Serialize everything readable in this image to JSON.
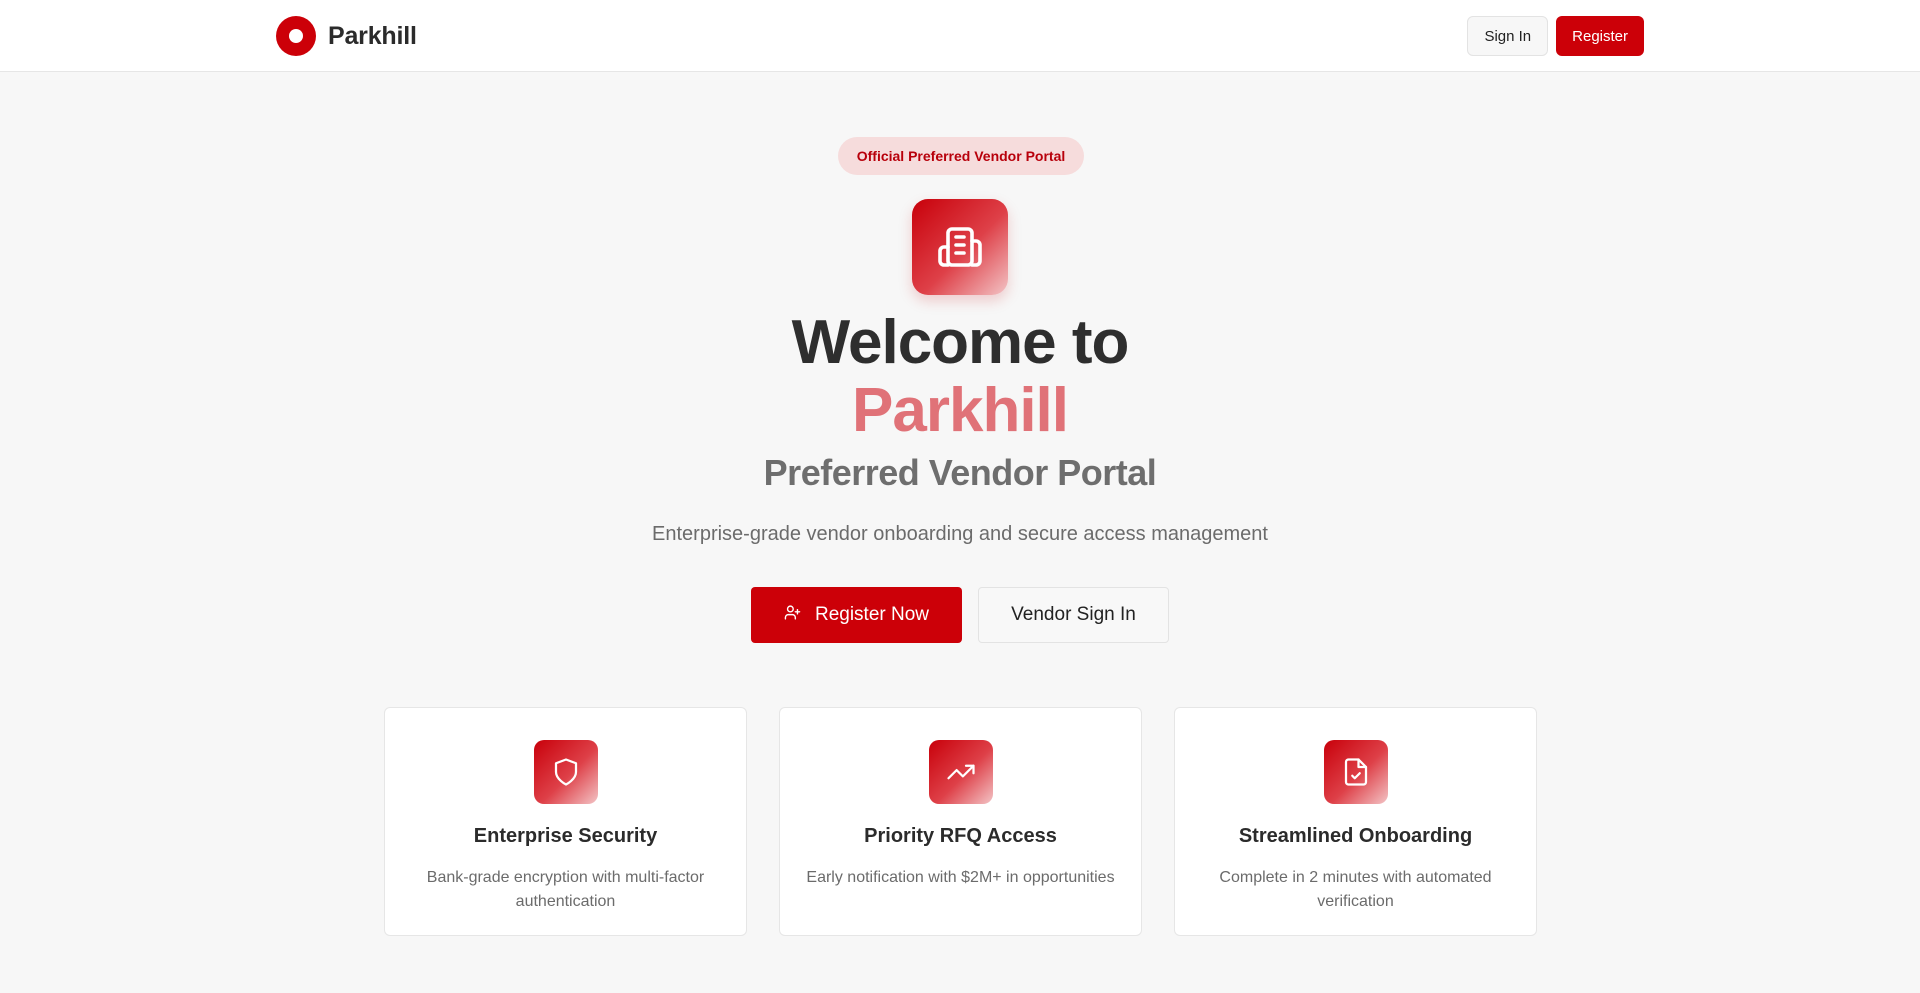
{
  "header": {
    "brand_name": "Parkhill",
    "sign_in_label": "Sign In",
    "register_label": "Register"
  },
  "hero": {
    "badge": "Official Preferred Vendor Portal",
    "icon": "building-icon",
    "title_line1": "Welcome to",
    "title_line2": "Parkhill",
    "title_line3": "Preferred Vendor Portal",
    "subtitle": "Enterprise-grade vendor onboarding and secure access management",
    "primary_cta": "Register Now",
    "primary_cta_icon": "user-plus-icon",
    "secondary_cta": "Vendor Sign In"
  },
  "features": [
    {
      "icon": "shield-icon",
      "title": "Enterprise Security",
      "description": "Bank-grade encryption with multi-factor authentication"
    },
    {
      "icon": "trending-up-icon",
      "title": "Priority RFQ Access",
      "description": "Early notification with $2M+ in opportunities"
    },
    {
      "icon": "file-check-icon",
      "title": "Streamlined Onboarding",
      "description": "Complete in 2 minutes with automated verification"
    }
  ],
  "colors": {
    "brand_red": "#cc0008",
    "accent_pink": "#e07278",
    "badge_bg": "#f6dcdc",
    "page_bg": "#f7f7f7"
  }
}
